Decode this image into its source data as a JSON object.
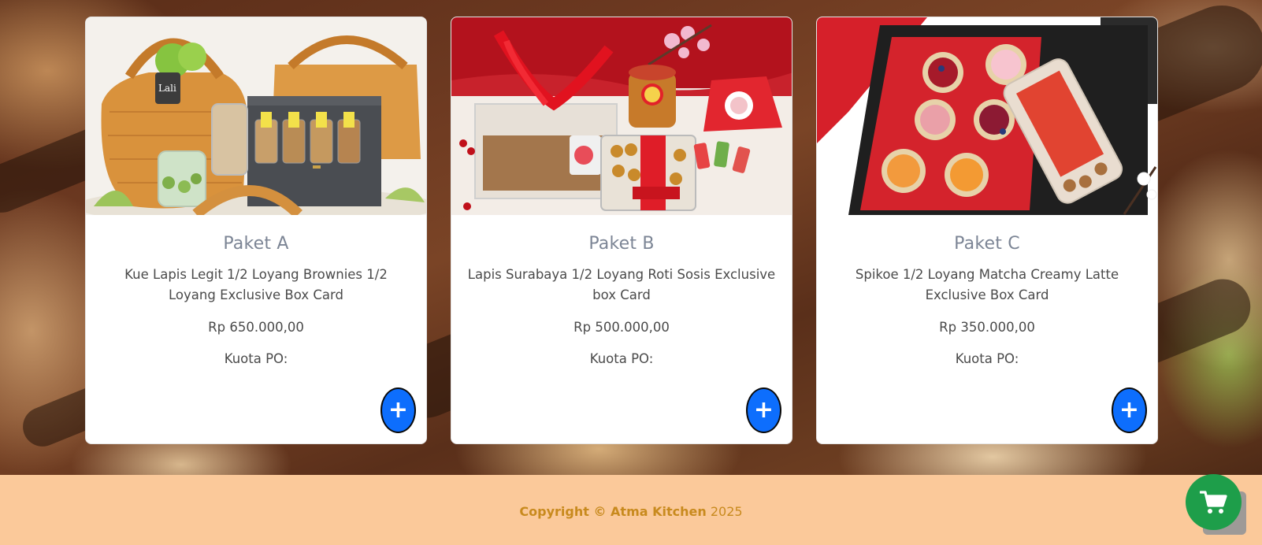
{
  "products": [
    {
      "title": "Paket A",
      "description": "Kue Lapis Legit 1/2 Loyang Brownies 1/2 Loyang Exclusive Box Card",
      "price": "Rp 650.000,00",
      "quota_label": "Kuota PO:",
      "add_label": "+"
    },
    {
      "title": "Paket B",
      "description": "Lapis Surabaya 1/2 Loyang Roti Sosis Exclusive box Card",
      "price": "Rp 500.000,00",
      "quota_label": "Kuota PO:",
      "add_label": "+"
    },
    {
      "title": "Paket C",
      "description": "Spikoe 1/2 Loyang Matcha Creamy Latte Exclusive Box Card",
      "price": "Rp 350.000,00",
      "quota_label": "Kuota PO:",
      "add_label": "+"
    }
  ],
  "footer": {
    "copyright_label": "Copyright © Atma Kitchen",
    "year": "2025"
  },
  "cart": {
    "icon": "shopping-cart-icon"
  },
  "colors": {
    "primary_button": "#0d6efd",
    "cart_button": "#1e9e4a",
    "footer_bg": "#fbc99a",
    "footer_text": "#c88a1e",
    "title_text": "#7c8595"
  }
}
